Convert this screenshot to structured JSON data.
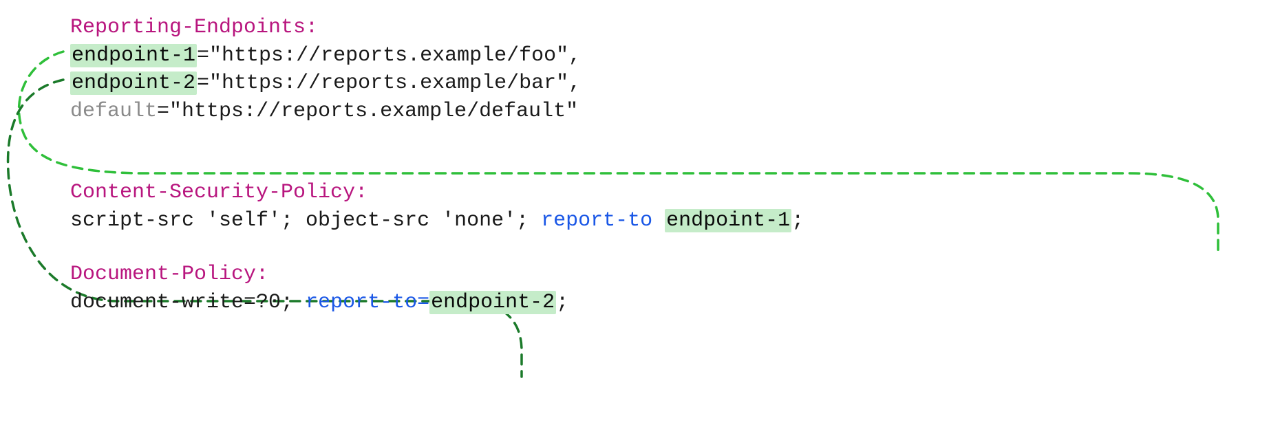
{
  "headers": {
    "reportingEndpoints": {
      "name": "Reporting-Endpoints:",
      "endpoints": [
        {
          "key": "endpoint-1",
          "url": "\"https://reports.example/foo\"",
          "trailing": ","
        },
        {
          "key": "endpoint-2",
          "url": "\"https://reports.example/bar\"",
          "trailing": ","
        },
        {
          "key": "default",
          "url": "\"https://reports.example/default\"",
          "trailing": ""
        }
      ]
    },
    "csp": {
      "name": "Content-Security-Policy:",
      "prefix": "script-src 'self'; object-src 'none'; ",
      "directive": "report-to ",
      "target": "endpoint-1",
      "suffix": ";"
    },
    "docPolicy": {
      "name": "Document-Policy:",
      "prefix": "document-write=?0; ",
      "directive": "report-to=",
      "target": "endpoint-2",
      "suffix": ";"
    }
  },
  "colors": {
    "headerName": "#b8157e",
    "plain": "#1a1a1a",
    "muted": "#8a8a8a",
    "directive": "#1a57e6",
    "highlightBg": "#c5ecc9",
    "arrowLight": "#2fbf3a",
    "arrowDark": "#1b7a2a"
  }
}
